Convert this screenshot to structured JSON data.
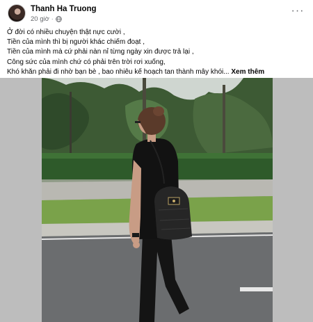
{
  "post": {
    "author": "Thanh Ha Truong",
    "time": "20 giờ",
    "separator": "·",
    "privacy_icon": "globe-icon",
    "more_icon": "more-horizontal-icon",
    "more_glyph": "···",
    "caption_lines": [
      "Ở đời có nhiều chuyện thật nực cười ,",
      "Tiền của mình thì bị người khác chiếm đoạt ,",
      "Tiền của mình mà cứ phải nàn nỉ từng ngày xin được trả lại ,",
      "Công sức của mình chứ có phải trên trời rơi xuống,",
      "Khó khăn phải đi nhờ bạn bè , bao nhiêu kế hoạch tan thành mây khói..."
    ],
    "see_more": "Xem thêm"
  },
  "colors": {
    "text": "#050505",
    "secondary_text": "#65676b",
    "media_side_bg": "#bdbdbd"
  }
}
